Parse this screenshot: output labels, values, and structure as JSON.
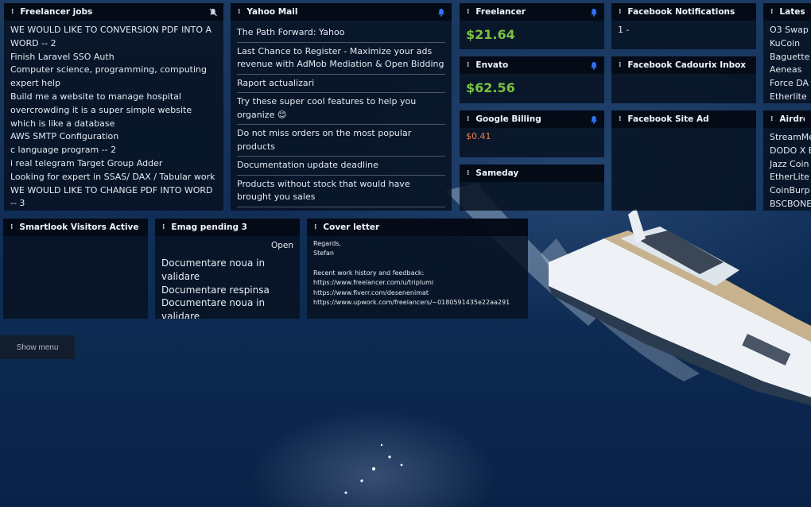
{
  "widgets": {
    "freelancer_jobs": {
      "title": "Freelancer jobs",
      "items": [
        "WE WOULD LIKE TO CONVERSION PDF INTO A WORD -- 2",
        "Finish Laravel SSO Auth",
        "Computer science, programming, computing expert help",
        "Build me a website to manage hospital overcrowding it is a super simple website which is like a database",
        "AWS SMTP Configuration",
        "c language program -- 2",
        "i real telegram Target Group Adder",
        "Looking for expert in SSAS/ DAX / Tabular work",
        "WE WOULD LIKE TO CHANGE PDF INTO WORD -- 3"
      ]
    },
    "yahoo_mail": {
      "title": "Yahoo Mail",
      "items": [
        "The Path Forward: Yahoo",
        "Last Chance to Register - Maximize your ads revenue with AdMob Mediation & Open Bidding",
        "Raport actualizari",
        "Try these super cool features to help you organize 😊",
        "Do not miss orders on the most popular products",
        "Documentation update deadline",
        "Products without stock that would have brought you sales"
      ]
    },
    "freelancer": {
      "title": "Freelancer",
      "amount": "$21.64"
    },
    "envato": {
      "title": "Envato",
      "amount": "$62.56"
    },
    "google_billing": {
      "title": "Google Billing",
      "amount": "$0.41"
    },
    "sameday": {
      "title": "Sameday"
    },
    "fb_notifications": {
      "title": "Facebook Notifications",
      "value": "1 -"
    },
    "fb_inbox": {
      "title": "Facebook Cadourix Inbox"
    },
    "fb_site_ad": {
      "title": "Facebook Site Ad"
    },
    "latest": {
      "title": "Latest A",
      "items": [
        "O3 Swap",
        "KuCoin",
        "Baguette",
        "Aeneas",
        "Force DA",
        "Etherlite"
      ]
    },
    "airdrop": {
      "title": "Airdrop",
      "items": [
        "StreamMe",
        "DODO X B",
        "Jazz Coin",
        "EtherLite",
        "CoinBurp",
        "BSCBONE"
      ]
    },
    "smartlook": {
      "title": "Smartlook Visitors Active 2"
    },
    "emag": {
      "title": "Emag pending 3",
      "open_label": "Open",
      "items": [
        "Documentare noua in validare",
        "Documentare respinsa",
        "Documentare noua in validare"
      ]
    },
    "cover_letter": {
      "title": "Cover letter",
      "lines": [
        "Regards,",
        "Stefan",
        "",
        "Recent work history and feedback:",
        "https://www.freelancer.com/u/triplumi",
        "https://www.fiverr.com/desenenimat",
        "https://www.upwork.com/freelancers/~0180591435e22aa291"
      ]
    }
  },
  "show_menu_label": "Show menu",
  "colors": {
    "money_green": "#7ac142",
    "money_orange": "#f07a4c",
    "bell_blue": "#2f74ff"
  }
}
